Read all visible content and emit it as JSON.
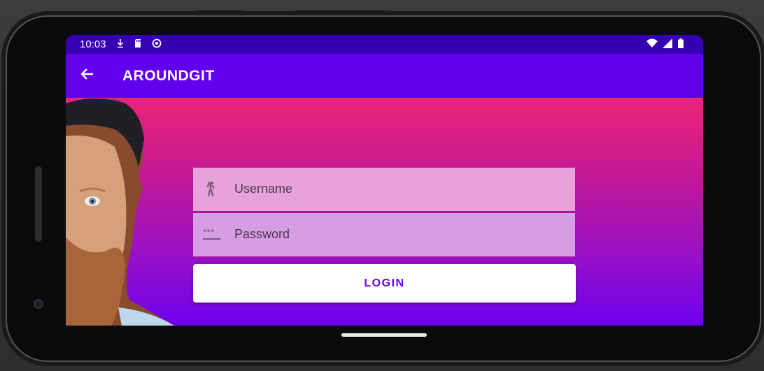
{
  "status_bar": {
    "time": "10:03",
    "left_icons": [
      "download-icon",
      "sd-card-icon",
      "sync-icon"
    ],
    "right_icons": [
      "wifi-icon",
      "signal-icon",
      "battery-icon"
    ]
  },
  "app_bar": {
    "title": "AROUNDGIT",
    "back_icon": "arrow-back-icon"
  },
  "form": {
    "username": {
      "placeholder": "Username",
      "value": "",
      "icon": "person-icon"
    },
    "password": {
      "placeholder": "Password",
      "value": "",
      "icon": "password-dots-icon"
    },
    "login_label": "LOGIN"
  },
  "colors": {
    "primary": "#6200ee",
    "primary_dark": "#3700b3",
    "gradient_top": "#ec2574",
    "gradient_bottom": "#6e00ee"
  }
}
